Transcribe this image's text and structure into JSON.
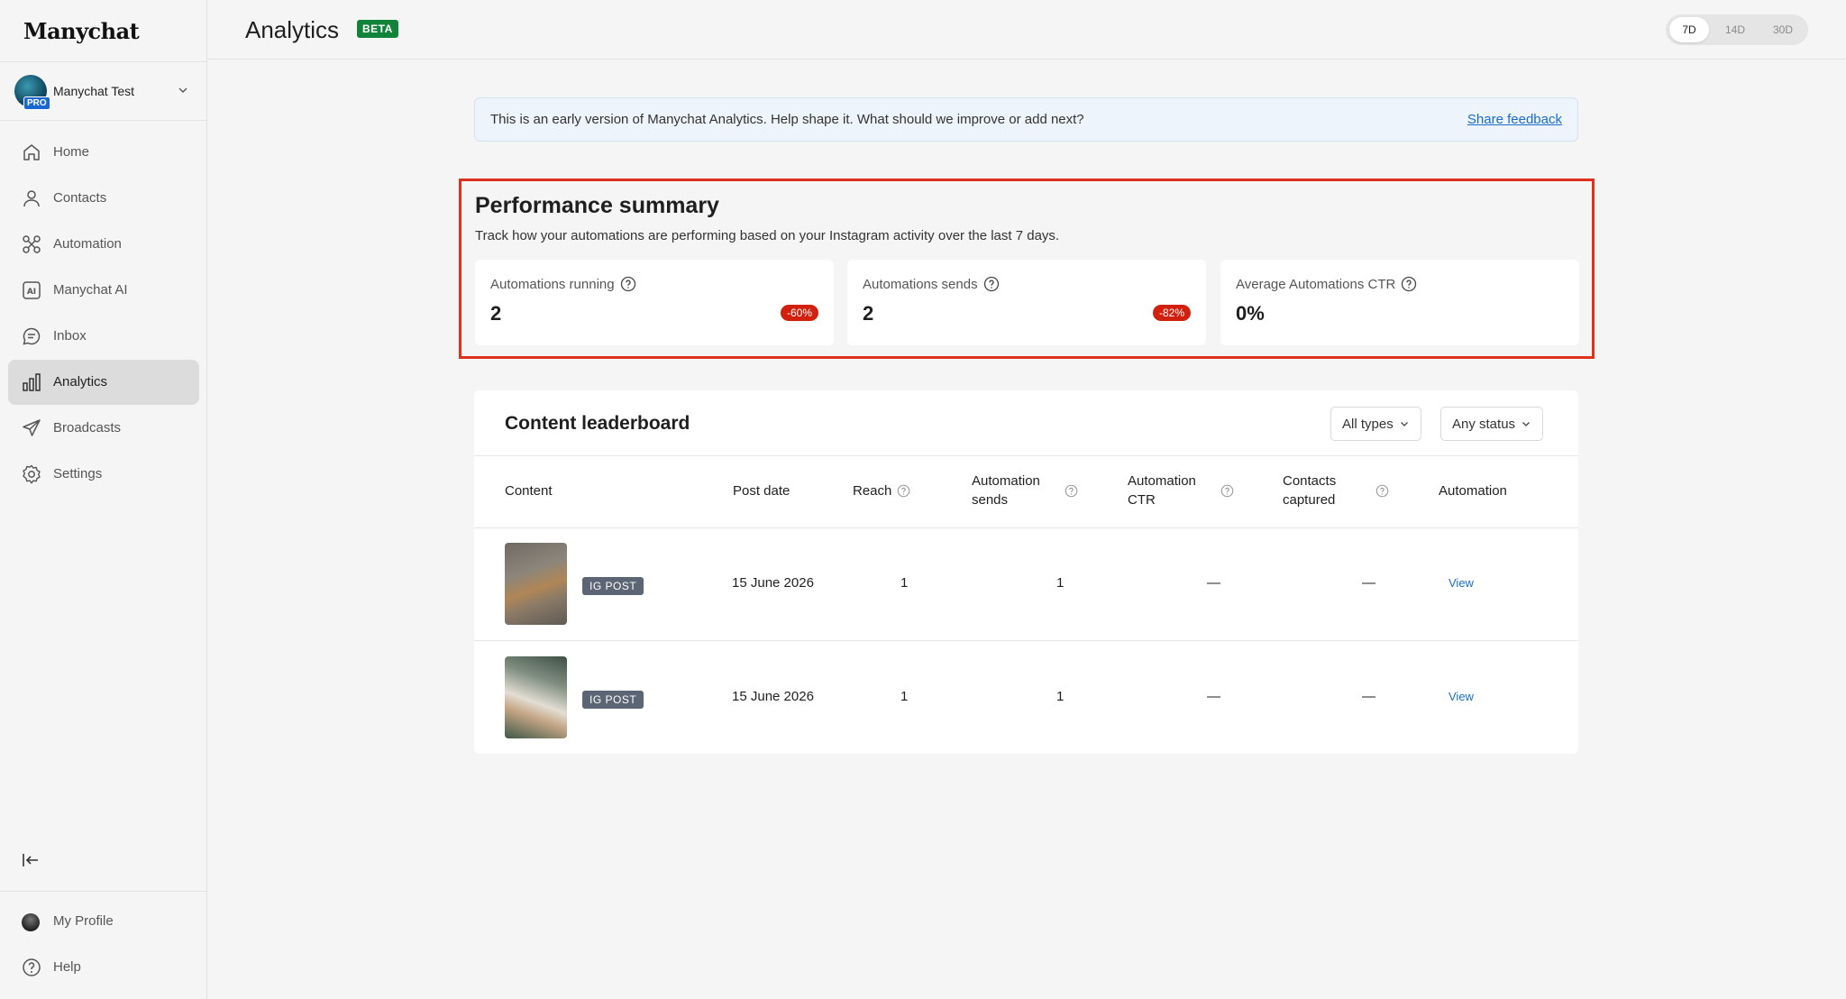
{
  "brand": {
    "logo": "Manychat"
  },
  "account": {
    "name": "Manychat Test",
    "badge": "PRO"
  },
  "nav": {
    "items": [
      {
        "label": "Home",
        "icon": "home-icon"
      },
      {
        "label": "Contacts",
        "icon": "user-icon"
      },
      {
        "label": "Automation",
        "icon": "automation-icon"
      },
      {
        "label": "Manychat AI",
        "icon": "ai-icon"
      },
      {
        "label": "Inbox",
        "icon": "chat-icon"
      },
      {
        "label": "Analytics",
        "icon": "bar-chart-icon",
        "active": true
      },
      {
        "label": "Broadcasts",
        "icon": "send-icon"
      },
      {
        "label": "Settings",
        "icon": "gear-icon"
      }
    ],
    "bottom": [
      {
        "label": "My Profile",
        "icon": "avatar"
      },
      {
        "label": "Help",
        "icon": "help-icon"
      }
    ]
  },
  "header": {
    "title": "Analytics",
    "badge": "BETA",
    "ranges": [
      "7D",
      "14D",
      "30D"
    ],
    "active_range": "7D"
  },
  "banner": {
    "text": "This is an early version of Manychat Analytics. Help shape it. What should we improve or add next?",
    "link": "Share feedback"
  },
  "performance": {
    "title": "Performance summary",
    "subtitle": "Track how your automations are performing based on your Instagram activity over the last 7 days.",
    "cards": [
      {
        "label": "Automations running",
        "value": "2",
        "delta": "-60%"
      },
      {
        "label": "Automations sends",
        "value": "2",
        "delta": "-82%"
      },
      {
        "label": "Average Automations CTR",
        "value": "0%"
      }
    ]
  },
  "leaderboard": {
    "title": "Content leaderboard",
    "filters": [
      "All types",
      "Any status"
    ],
    "columns": [
      "Content",
      "Post date",
      "Reach",
      "Automation sends",
      "Automation CTR",
      "Contacts captured",
      "Automation"
    ],
    "rows": [
      {
        "type": "IG POST",
        "post_date": "15 June 2026",
        "reach": "1",
        "sends": "1",
        "ctr": "—",
        "contacts": "—",
        "action": "View"
      },
      {
        "type": "IG POST",
        "post_date": "15 June 2026",
        "reach": "1",
        "sends": "1",
        "ctr": "—",
        "contacts": "—",
        "action": "View"
      }
    ]
  },
  "colors": {
    "accent": "#1a6dcf",
    "beta": "#12833b",
    "delta_negative": "#d2200e",
    "highlight": "#e0301e"
  }
}
